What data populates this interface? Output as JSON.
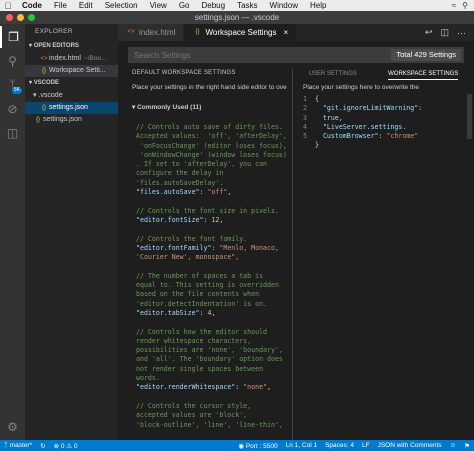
{
  "menubar": {
    "items": [
      "Code",
      "File",
      "Edit",
      "Selection",
      "View",
      "Go",
      "Debug",
      "Tasks",
      "Window",
      "Help"
    ]
  },
  "titlebar": {
    "title": "settings.json — .vscode"
  },
  "activity": {
    "scm_badge": "5K"
  },
  "sidebar": {
    "title": "EXPLORER",
    "open_editors_label": "OPEN EDITORS",
    "open_editors": [
      {
        "name": "index.html",
        "path": "~/Boo..."
      },
      {
        "name": "Workspace Setti..."
      }
    ],
    "folder_section": "VSCODE",
    "tree": [
      {
        "name": ".vscode",
        "type": "folder"
      },
      {
        "name": "settings.json",
        "type": "file"
      },
      {
        "name": "settings.json",
        "type": "file"
      }
    ]
  },
  "tabs": [
    {
      "label": "index.html",
      "active": false
    },
    {
      "label": "Workspace Settings",
      "active": true
    }
  ],
  "search": {
    "placeholder": "Search Settings",
    "total": "Total 429 Settings"
  },
  "default_pane": {
    "title": "DEFAULT WORKSPACE SETTINGS",
    "info": "Place your settings in the right hand side editor to ove",
    "group": "Commonly Used (11)",
    "lines": [
      {
        "t": "com",
        "s": "// Controls auto save of dirty files."
      },
      {
        "t": "com",
        "s": "Accepted values:  'off', 'afterDelay',"
      },
      {
        "t": "com",
        "s": " 'onFocusChange' (editor loses focus),"
      },
      {
        "t": "com",
        "s": " 'onWindowChange' (window loses focus)"
      },
      {
        "t": "com",
        "s": ". If set to 'afterDelay', you can"
      },
      {
        "t": "com",
        "s": "configure the delay in"
      },
      {
        "t": "com",
        "s": "'files.autoSaveDelay'."
      },
      {
        "t": "kv",
        "k": "\"files.autoSave\"",
        "sep": ": ",
        "v": "\"off\"",
        "vt": "str",
        "end": ","
      },
      {
        "t": "blank",
        "s": " "
      },
      {
        "t": "com",
        "s": "// Controls the font size in pixels."
      },
      {
        "t": "kv",
        "k": "\"editor.fontSize\"",
        "sep": ": ",
        "v": "12",
        "vt": "num",
        "end": ","
      },
      {
        "t": "blank",
        "s": " "
      },
      {
        "t": "com",
        "s": "// Controls the font family."
      },
      {
        "t": "kv",
        "k": "\"editor.fontFamily\"",
        "sep": ": ",
        "v": "\"Menlo, Monaco,",
        "vt": "str",
        "end": ""
      },
      {
        "t": "str",
        "s": "'Courier New', monospace\","
      },
      {
        "t": "blank",
        "s": " "
      },
      {
        "t": "com",
        "s": "// The number of spaces a tab is"
      },
      {
        "t": "com",
        "s": "equal to. This setting is overridden"
      },
      {
        "t": "com",
        "s": "based on the file contents when"
      },
      {
        "t": "com",
        "s": "'editor.detectIndentation' is on."
      },
      {
        "t": "kv",
        "k": "\"editor.tabSize\"",
        "sep": ": ",
        "v": "4",
        "vt": "num",
        "end": ","
      },
      {
        "t": "blank",
        "s": " "
      },
      {
        "t": "com",
        "s": "// Controls how the editor should"
      },
      {
        "t": "com",
        "s": "render whitespace characters,"
      },
      {
        "t": "com",
        "s": "possibilities are 'none', 'boundary',"
      },
      {
        "t": "com",
        "s": "and 'all'. The 'boundary' option does"
      },
      {
        "t": "com",
        "s": "not render single spaces between"
      },
      {
        "t": "com",
        "s": "words."
      },
      {
        "t": "kv",
        "k": "\"editor.renderWhitespace\"",
        "sep": ": ",
        "v": "\"none\"",
        "vt": "str",
        "end": ","
      },
      {
        "t": "blank",
        "s": " "
      },
      {
        "t": "com",
        "s": "// Controls the cursor style,"
      },
      {
        "t": "com",
        "s": "accepted values are 'block',"
      },
      {
        "t": "com",
        "s": "'block-outline', 'line', 'line-thin',"
      }
    ]
  },
  "user_pane": {
    "tabs": [
      {
        "label": "USER SETTINGS",
        "active": false
      },
      {
        "label": "WORKSPACE SETTINGS",
        "active": true
      }
    ],
    "info": "Place your settings here to overwrite the",
    "gutter": [
      "1",
      "2",
      "3",
      "4",
      "5"
    ],
    "lines": [
      {
        "t": "pun",
        "s": "{"
      },
      {
        "t": "kv",
        "k": "  \"git.ignoreLimitWarning\"",
        "sep": ":",
        "v": "",
        "vt": "str",
        "end": ""
      },
      {
        "t": "plain",
        "s": "  true,",
        "c": "c-key"
      },
      {
        "t": "kv",
        "k": "  \"LiveServer.settings.",
        "sep": "",
        "v": "",
        "vt": "str",
        "end": ""
      },
      {
        "t": "kv",
        "k": "  CustomBrowser\"",
        "sep": ": ",
        "v": "\"chrome\"",
        "vt": "str",
        "end": ""
      },
      {
        "t": "pun",
        "s": "}"
      }
    ]
  },
  "status": {
    "branch": "master*",
    "errors": "0",
    "warnings": "0",
    "port": "Port : 5500",
    "position": "Ln 1, Col 1",
    "spaces": "Spaces: 4",
    "eol": "LF",
    "language": "JSON with Comments"
  }
}
